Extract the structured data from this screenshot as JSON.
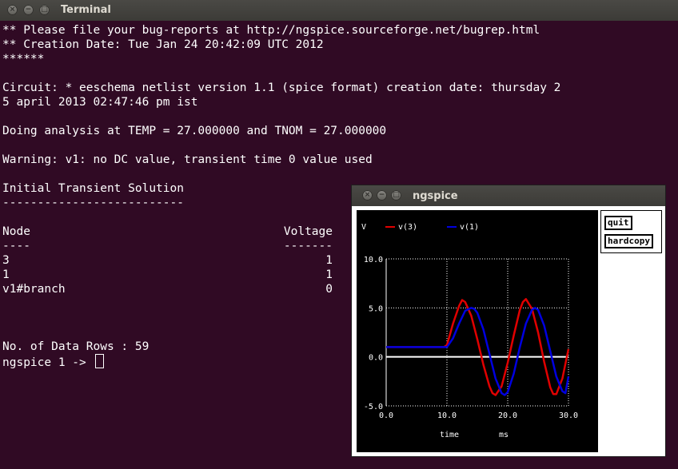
{
  "window": {
    "title": "Terminal"
  },
  "terminal": {
    "lines": [
      "** Please file your bug-reports at http://ngspice.sourceforge.net/bugrep.html",
      "** Creation Date: Tue Jan 24 20:42:09 UTC 2012",
      "******",
      "Circuit: * eeschema netlist version 1.1 (spice format) creation date: thursday 2",
      "5 april 2013 02:47:46 pm ist",
      "Doing analysis at TEMP = 27.000000 and TNOM = 27.000000",
      "Warning: v1: no DC value, transient time 0 value used",
      "Initial Transient Solution",
      "--------------------------",
      "Node",
      "----",
      "3",
      "1",
      "v1#branch",
      "No. of Data Rows : 59"
    ],
    "voltage_header": "Voltage",
    "voltage_dashes": "-------",
    "voltage_values": [
      "1",
      "1",
      "0"
    ],
    "prompt": "ngspice 1 -> "
  },
  "ngspice": {
    "title": "ngspice",
    "buttons": {
      "quit": "quit",
      "hardcopy": "hardcopy"
    }
  },
  "chart_data": {
    "type": "line",
    "ylabel": "V",
    "xlabel": "time",
    "xunit": "ms",
    "xlim": [
      0,
      30
    ],
    "ylim": [
      -5,
      10
    ],
    "xticks": [
      "0.0",
      "10.0",
      "20.0",
      "30.0"
    ],
    "yticks": [
      "10.0",
      "5.0",
      "0.0",
      "-5.0"
    ],
    "grid": true,
    "legend": "top",
    "series": [
      {
        "name": "v(3)",
        "color": "#e00000",
        "x": [
          0,
          9.5,
          10,
          11,
          12,
          12.5,
          13,
          14,
          15,
          16,
          17,
          17.5,
          18,
          19,
          20,
          21,
          22,
          22.5,
          23,
          24,
          25,
          26,
          27,
          27.5,
          28,
          29,
          30
        ],
        "y": [
          1,
          1,
          1.2,
          3.4,
          5.2,
          5.8,
          5.6,
          4.2,
          1.8,
          -0.8,
          -3.0,
          -3.7,
          -3.9,
          -3.0,
          -0.6,
          2.2,
          4.8,
          5.6,
          5.9,
          4.9,
          2.5,
          -0.5,
          -3.1,
          -3.8,
          -3.8,
          -2.2,
          0.8
        ]
      },
      {
        "name": "v(1)",
        "color": "#0000e0",
        "x": [
          0,
          10,
          11,
          12,
          13,
          14,
          14.5,
          15,
          16,
          17,
          18,
          19,
          19.5,
          20,
          21,
          22,
          23,
          24,
          24.5,
          25,
          26,
          27,
          28,
          29,
          29.5,
          30
        ],
        "y": [
          1,
          1,
          1.9,
          3.4,
          4.7,
          5.0,
          4.9,
          4.5,
          2.8,
          0.3,
          -2.2,
          -3.7,
          -3.9,
          -3.6,
          -1.7,
          1.0,
          3.4,
          4.8,
          5.0,
          4.8,
          3.2,
          0.6,
          -2.0,
          -3.5,
          -3.7,
          -2.0
        ]
      }
    ]
  }
}
